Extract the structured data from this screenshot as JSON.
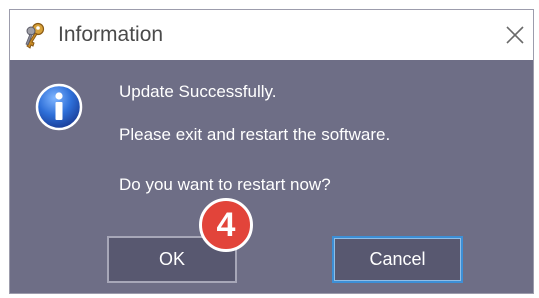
{
  "window": {
    "title": "Information",
    "icon": "key-icon",
    "close_icon": "close-icon"
  },
  "message": {
    "icon": "info-icon",
    "line1": "Update Successfully.",
    "line2": "Please exit and restart the software.",
    "line3": "Do you want to restart now?"
  },
  "buttons": {
    "ok_label": "OK",
    "cancel_label": "Cancel"
  },
  "annotation": {
    "step_number": "4",
    "color": "#e2443a"
  },
  "colors": {
    "dialog_body": "#6e6e86",
    "button_face": "#585870",
    "focus_border": "#3d8fd6"
  }
}
